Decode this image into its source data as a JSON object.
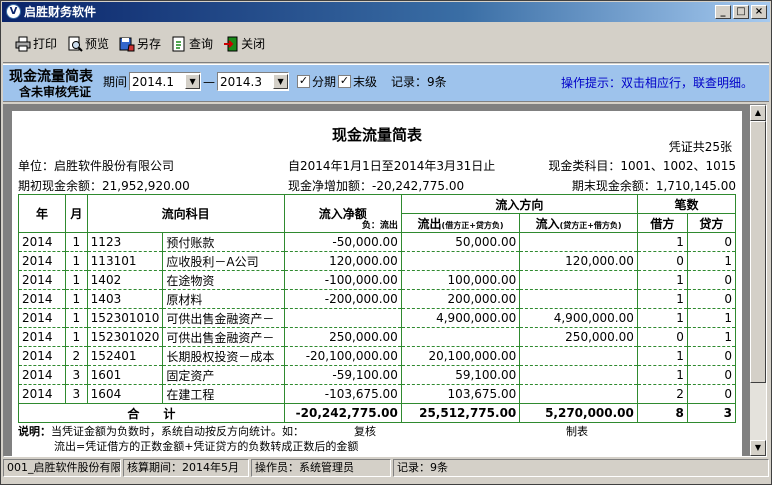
{
  "window": {
    "title": "启胜财务软件",
    "app_icon": "V"
  },
  "toolbar": {
    "print": "打印",
    "preview": "预览",
    "saveas": "另存",
    "query": "查询",
    "close": "关闭"
  },
  "filter": {
    "title": "现金流量简表",
    "subtitle": "含未审核凭证",
    "period_label": "期间",
    "period_from": "2014.1",
    "dash": "—",
    "period_to": "2014.3",
    "split_label": "分期",
    "final_label": "末级",
    "record_label": "记录：9条",
    "hint": "操作提示：双击相应行，联查明细。"
  },
  "report": {
    "title": "现金流量简表",
    "voucher_count": "凭证共25张",
    "unit": "单位：启胜软件股份有限公司",
    "range": "自2014年1月1日至2014年3月31日止",
    "subjects": "现金类科目：1001、1002、1015",
    "opening": "期初现金余额：21,952,920.00",
    "net_increase": "现金净增加额：-20,242,775.00",
    "closing": "期末现金余额：1,710,145.00",
    "headers": {
      "year": "年",
      "month": "月",
      "subject": "流向科目",
      "net": "流入净额",
      "net_sub": "负：流出",
      "direction": "流入方向",
      "outflow": "流出",
      "outflow_sub": "(借方正+贷方负)",
      "inflow": "流入",
      "inflow_sub": "(贷方正+借方负)",
      "count": "笔数",
      "debit": "借方",
      "credit": "贷方"
    },
    "rows": [
      {
        "year": "2014",
        "month": "1",
        "code": "1123",
        "name": "预付账款",
        "net": "-50,000.00",
        "out": "50,000.00",
        "in": "",
        "debit": "1",
        "credit": "0"
      },
      {
        "year": "2014",
        "month": "1",
        "code": "113101",
        "name": "应收股利－A公司",
        "net": "120,000.00",
        "out": "",
        "in": "120,000.00",
        "debit": "0",
        "credit": "1"
      },
      {
        "year": "2014",
        "month": "1",
        "code": "1402",
        "name": "在途物资",
        "net": "-100,000.00",
        "out": "100,000.00",
        "in": "",
        "debit": "1",
        "credit": "0"
      },
      {
        "year": "2014",
        "month": "1",
        "code": "1403",
        "name": "原材料",
        "net": "-200,000.00",
        "out": "200,000.00",
        "in": "",
        "debit": "1",
        "credit": "0"
      },
      {
        "year": "2014",
        "month": "1",
        "code": "152301010",
        "name": "可供出售金融资产－",
        "net": "",
        "out": "4,900,000.00",
        "in": "4,900,000.00",
        "debit": "1",
        "credit": "1"
      },
      {
        "year": "2014",
        "month": "1",
        "code": "152301020",
        "name": "可供出售金融资产－",
        "net": "250,000.00",
        "out": "",
        "in": "250,000.00",
        "debit": "0",
        "credit": "1"
      },
      {
        "year": "2014",
        "month": "2",
        "code": "152401",
        "name": "长期股权投资－成本",
        "net": "-20,100,000.00",
        "out": "20,100,000.00",
        "in": "",
        "debit": "1",
        "credit": "0"
      },
      {
        "year": "2014",
        "month": "3",
        "code": "1601",
        "name": "固定资产",
        "net": "-59,100.00",
        "out": "59,100.00",
        "in": "",
        "debit": "1",
        "credit": "0"
      },
      {
        "year": "2014",
        "month": "3",
        "code": "1604",
        "name": "在建工程",
        "net": "-103,675.00",
        "out": "103,675.00",
        "in": "",
        "debit": "2",
        "credit": "0"
      }
    ],
    "total": {
      "label": "合　　计",
      "net": "-20,242,775.00",
      "out": "25,512,775.00",
      "in": "5,270,000.00",
      "debit": "8",
      "credit": "3"
    },
    "note_label": "说明：",
    "note1": "当凭证金额为负数时，系统自动按反方向统计。如：",
    "note2": "流出=凭证借方的正数金额+凭证贷方的负数转成正数后的金额",
    "review": "复核",
    "maker": "制表"
  },
  "status": {
    "company": "001_启胜软件股份有限",
    "period": "核算期间：2014年5月",
    "operator": "操作员：系统管理员",
    "records": "记录：9条"
  }
}
